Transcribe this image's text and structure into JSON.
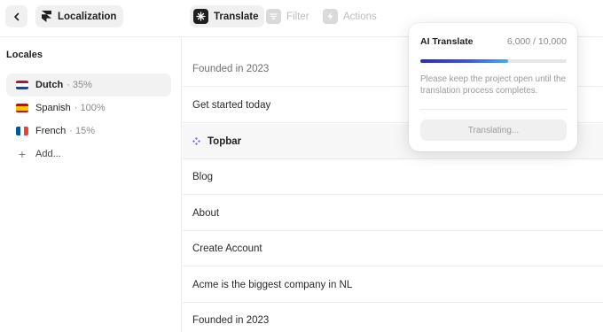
{
  "header": {
    "back_icon": "chevron-left-icon",
    "project_label": "Localization",
    "project_icon": "framer-logo-icon",
    "tools": {
      "translate": "Translate",
      "filter": "Filter",
      "actions": "Actions"
    }
  },
  "sidebar": {
    "title": "Locales",
    "locales": [
      {
        "name": "Dutch",
        "progress": "· 35%",
        "flag": "nl-flag-icon"
      },
      {
        "name": "Spanish",
        "progress": "· 100%",
        "flag": "es-flag-icon"
      },
      {
        "name": "French",
        "progress": "· 15%",
        "flag": "fr-flag-icon"
      }
    ],
    "add_label": "Add..."
  },
  "main": {
    "rows": [
      "Founded in 2023",
      "Get started today",
      "Topbar",
      "Blog",
      "About",
      "Create Account",
      "Acme is the biggest company in NL",
      "Founded in 2023"
    ]
  },
  "translate_popover": {
    "title": "AI Translate",
    "count": "6,000 / 10,000",
    "progress": 0.6,
    "message": "Please keep the project open until the translation process completes.",
    "button_label": "Translating..."
  },
  "colors": {
    "accent_start": "#2a2bb8",
    "accent_end": "#4fa8ee",
    "group_icon": "#8e6bd8"
  }
}
